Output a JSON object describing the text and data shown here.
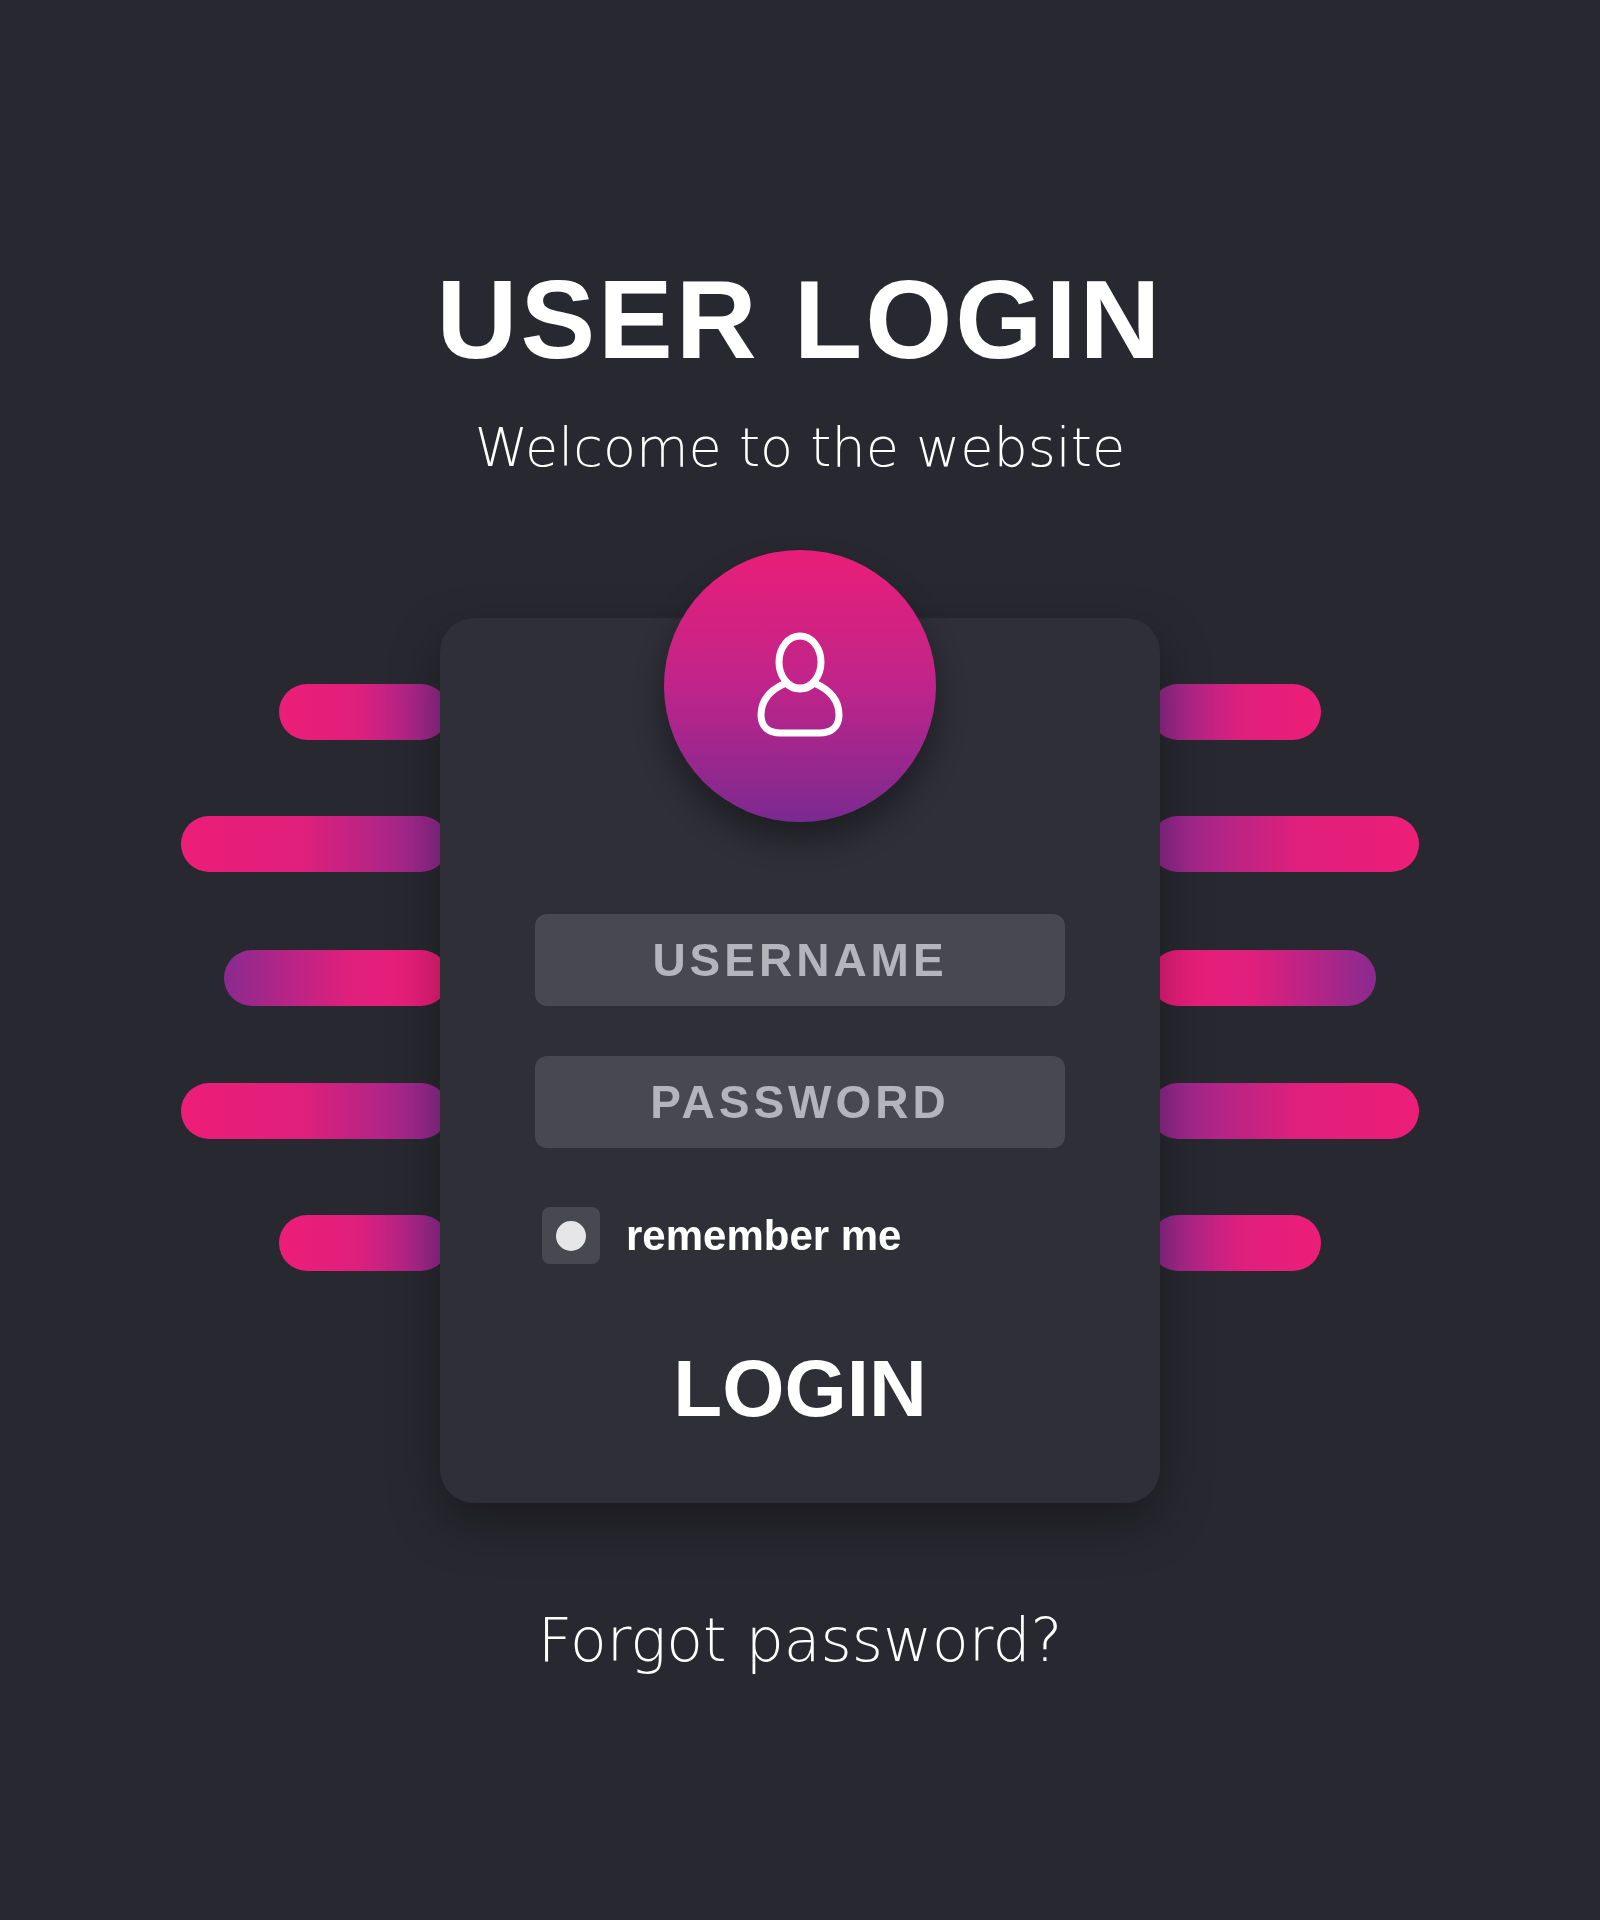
{
  "title": "USER LOGIN",
  "subtitle": "Welcome to the website",
  "form": {
    "username": {
      "placeholder": "USERNAME"
    },
    "password": {
      "placeholder": "PASSWORD"
    },
    "remember": {
      "label": "remember me",
      "checked": true
    },
    "submit": "LOGIN"
  },
  "forgot_link": "Forgot password?"
}
